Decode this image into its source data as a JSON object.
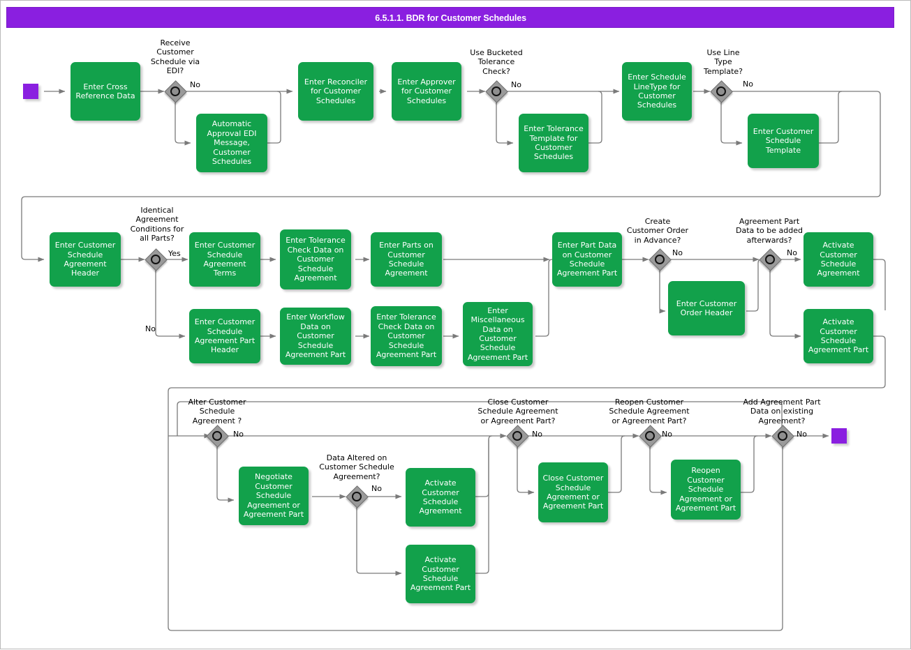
{
  "header": {
    "title": "6.5.1.1. BDR for Customer Schedules",
    "bar_color": "#8A1FE0"
  },
  "palette": {
    "task_fill": "#12A14B",
    "gateway_fill": "#9A9A9A",
    "marker_fill": "#8A1FE0",
    "connector": "#7a7a7a",
    "text_on_task": "#FFFFFF",
    "label_text": "#000000"
  },
  "markers": [
    {
      "name": "start-event",
      "label": ""
    },
    {
      "name": "end-event",
      "label": ""
    }
  ],
  "tasks": [
    {
      "id": "t_cross_ref",
      "label": "Enter Cross\nReference Data"
    },
    {
      "id": "t_auto_approval",
      "label": "Automatic\nApproval EDI\nMessage,\nCustomer\nSchedules"
    },
    {
      "id": "t_reconciler",
      "label": "Enter Reconciler\nfor Customer\nSchedules"
    },
    {
      "id": "t_approver",
      "label": "Enter Approver\nfor Customer\nSchedules"
    },
    {
      "id": "t_tol_template",
      "label": "Enter Tolerance\nTemplate for\nCustomer\nSchedules"
    },
    {
      "id": "t_schedule_linetype",
      "label": "Enter Schedule\nLineType for\nCustomer\nSchedules"
    },
    {
      "id": "t_cust_sched_template",
      "label": "Enter Customer\nSchedule\nTemplate"
    },
    {
      "id": "t_agr_header",
      "label": "Enter Customer\nSchedule\nAgreement\nHeader"
    },
    {
      "id": "t_agr_terms",
      "label": "Enter Customer\nSchedule\nAgreement\nTerms"
    },
    {
      "id": "t_tol_check_agr",
      "label": "Enter Tolerance\nCheck Data on\nCustomer\nSchedule\nAgreement"
    },
    {
      "id": "t_parts_on_agr",
      "label": "Enter Parts on\nCustomer\nSchedule\nAgreement"
    },
    {
      "id": "t_agr_part_header",
      "label": "Enter Customer\nSchedule\nAgreement Part\nHeader"
    },
    {
      "id": "t_workflow_part",
      "label": "Enter Workflow\nData on\nCustomer\nSchedule\nAgreement Part"
    },
    {
      "id": "t_tol_check_part",
      "label": "Enter Tolerance\nCheck Data on\nCustomer\nSchedule\nAgreement Part"
    },
    {
      "id": "t_misc_part",
      "label": "Enter\nMiscellaneous\nData on\nCustomer\nSchedule\nAgreement Part"
    },
    {
      "id": "t_part_data",
      "label": "Enter Part Data\non Customer\nSchedule\nAgreement Part"
    },
    {
      "id": "t_order_header",
      "label": "Enter Customer\nOrder Header"
    },
    {
      "id": "t_activate_agr",
      "label": "Activate\nCustomer\nSchedule\nAgreement"
    },
    {
      "id": "t_activate_agr_part",
      "label": "Activate\nCustomer\nSchedule\nAgreement Part"
    },
    {
      "id": "t_negotiate",
      "label": "Negotiate\nCustomer\nSchedule\nAgreement or\nAgreement Part"
    },
    {
      "id": "t_activate_agr2",
      "label": "Activate\nCustomer\nSchedule\nAgreement"
    },
    {
      "id": "t_activate_agr_part2",
      "label": "Activate\nCustomer\nSchedule\nAgreement Part"
    },
    {
      "id": "t_close",
      "label": "Close Customer\nSchedule\nAgreement or\nAgreement Part"
    },
    {
      "id": "t_reopen",
      "label": "Reopen\nCustomer\nSchedule\nAgreement or\nAgreement Part"
    }
  ],
  "gateways": [
    {
      "id": "g_edi",
      "question": "Receive\nCustomer\nSchedule via\nEDI?",
      "branch": "No"
    },
    {
      "id": "g_bucketed",
      "question": "Use Bucketed\nTolerance\nCheck?",
      "branch": "No"
    },
    {
      "id": "g_linetype",
      "question": "Use Line\nType\nTemplate?",
      "branch": "No"
    },
    {
      "id": "g_identical",
      "question": "Identical\nAgreement\nConditions for\nall Parts?",
      "branch": "Yes",
      "branch2": "No"
    },
    {
      "id": "g_create_order",
      "question": "Create\nCustomer Order\nin Advance?",
      "branch": "No"
    },
    {
      "id": "g_part_after",
      "question": "Agreement Part\nData to be added\nafterwards?",
      "branch": "No"
    },
    {
      "id": "g_alter",
      "question": "Alter Customer\nSchedule\nAgreement ?",
      "branch": "No"
    },
    {
      "id": "g_data_alt",
      "question": "Data Altered on\nCustomer Schedule\nAgreement?",
      "branch": "No"
    },
    {
      "id": "g_close",
      "question": "Close Customer\nSchedule Agreement\nor Agreement Part?",
      "branch": "No"
    },
    {
      "id": "g_reopen",
      "question": "Reopen Customer\nSchedule Agreement\nor Agreement Part?",
      "branch": "No"
    },
    {
      "id": "g_add_part",
      "question": "Add Agreement Part\nData on existing\nAgreement?",
      "branch": "No"
    }
  ]
}
